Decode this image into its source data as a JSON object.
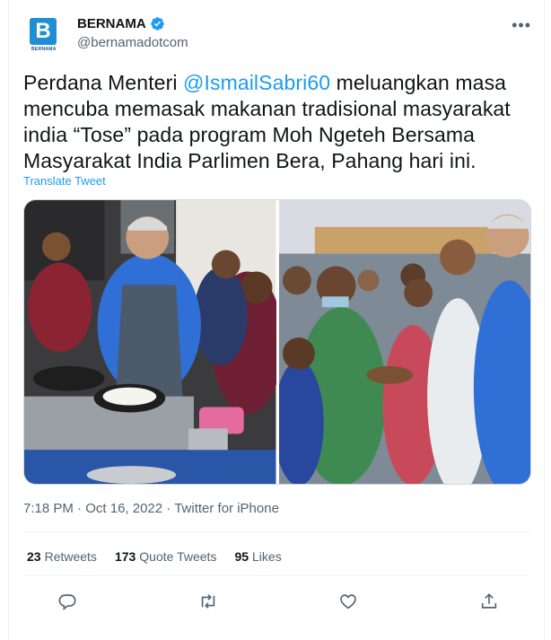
{
  "author": {
    "display_name": "BERNAMA",
    "handle": "@bernamadotcom",
    "logo_letter": "B",
    "logo_caption": "BERNAMA",
    "verified_icon": "verified-badge-icon"
  },
  "more_label": "•••",
  "tweet": {
    "line1_pre": "Perdana Menteri ",
    "mention": "@IsmailSabri60",
    "line1_post": " meluangkan masa",
    "line2": "mencuba memasak makanan tradisional masyarakat",
    "line3": "india “Tose” pada program Moh Ngeteh Bersama",
    "line4": "Masyarakat India Parlimen Bera, Pahang hari ini."
  },
  "translate_label": "Translate Tweet",
  "meta": {
    "time": "7:18 PM",
    "separator1": " · ",
    "date": "Oct 16, 2022",
    "separator2": " · ",
    "source": "Twitter for iPhone"
  },
  "stats": {
    "retweets_count": "23",
    "retweets_label": "Retweets",
    "quotes_count": "173",
    "quotes_label": "Quote Tweets",
    "likes_count": "95",
    "likes_label": "Likes"
  },
  "actions": [
    "reply-icon",
    "retweet-icon",
    "like-icon",
    "share-icon"
  ],
  "colors": {
    "accent": "#1d9bf0",
    "text": "#0f1419",
    "secondary": "#536471",
    "border": "#eff3f4",
    "brand": "#1f8fd3"
  }
}
